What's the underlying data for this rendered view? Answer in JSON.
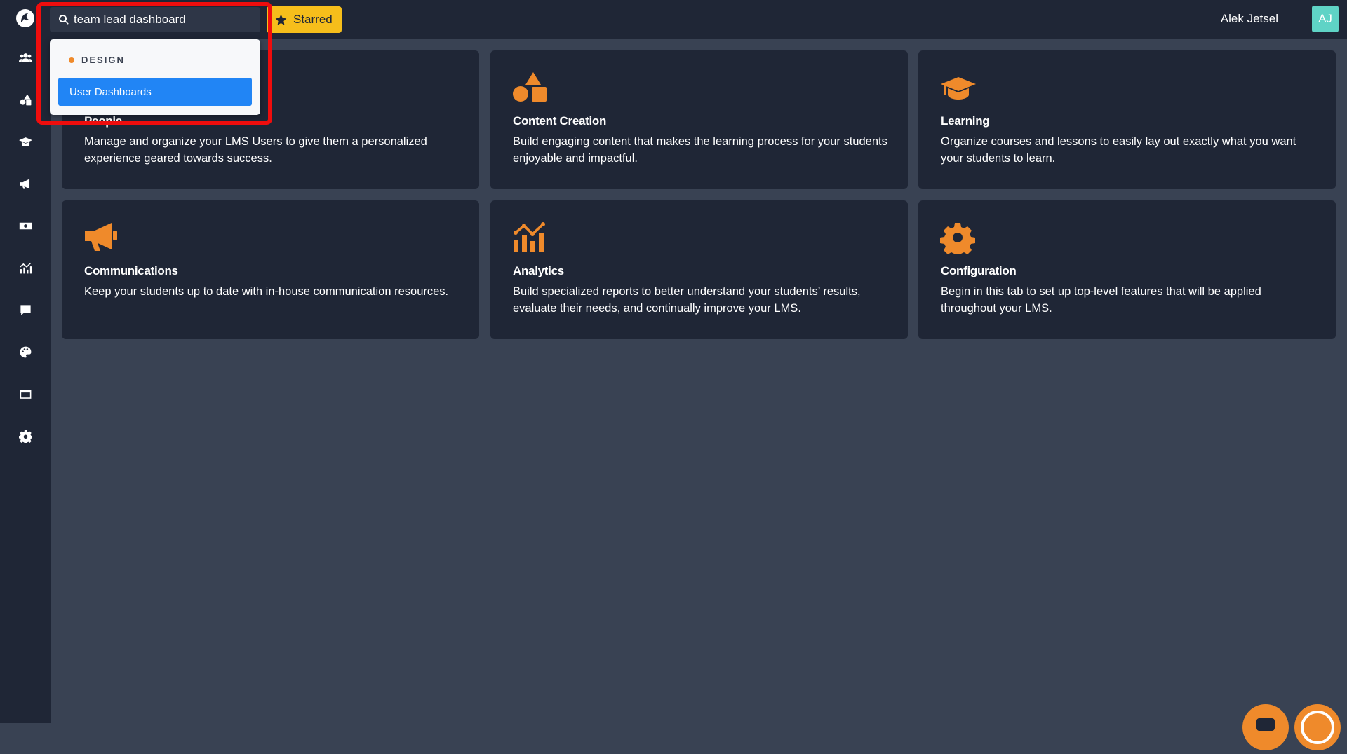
{
  "topbar": {
    "search_value": "team lead dashboard",
    "starred_label": "Starred",
    "user_name": "Alek Jetsel",
    "user_initials": "AJ"
  },
  "search_dropdown": {
    "group_label": "DESIGN",
    "items": [
      {
        "label": "User Dashboards"
      }
    ]
  },
  "sidebar": {
    "items": [
      {
        "icon": "users-icon"
      },
      {
        "icon": "shapes-icon"
      },
      {
        "icon": "graduation-cap-icon"
      },
      {
        "icon": "megaphone-icon"
      },
      {
        "icon": "money-icon"
      },
      {
        "icon": "analytics-icon"
      },
      {
        "icon": "comment-icon"
      },
      {
        "icon": "palette-icon"
      },
      {
        "icon": "window-icon"
      },
      {
        "icon": "gear-icon"
      }
    ]
  },
  "cards": [
    {
      "title": "People",
      "description": "Manage and organize your LMS Users to give them a personalized experience geared towards success.",
      "icon": "users-icon"
    },
    {
      "title": "Content Creation",
      "description": "Build engaging content that makes the learning process for your students enjoyable and impactful.",
      "icon": "shapes-icon"
    },
    {
      "title": "Learning",
      "description": "Organize courses and lessons to easily lay out exactly what you want your students to learn.",
      "icon": "graduation-cap-icon"
    },
    {
      "title": "Communications",
      "description": "Keep your students up to date with in-house communication resources.",
      "icon": "megaphone-icon"
    },
    {
      "title": "Analytics",
      "description": "Build specialized reports to better understand your students’ results, evaluate their needs, and continually improve your LMS.",
      "icon": "analytics-icon"
    },
    {
      "title": "Configuration",
      "description": "Begin in this tab to set up top-level features that will be applied throughout your LMS.",
      "icon": "gear-icon"
    }
  ],
  "colors": {
    "accent": "#ef8a2b",
    "starred": "#f6be1b",
    "selection": "#2185f5",
    "highlight_box": "#ef0d0d",
    "avatar": "#5fd3c6"
  }
}
